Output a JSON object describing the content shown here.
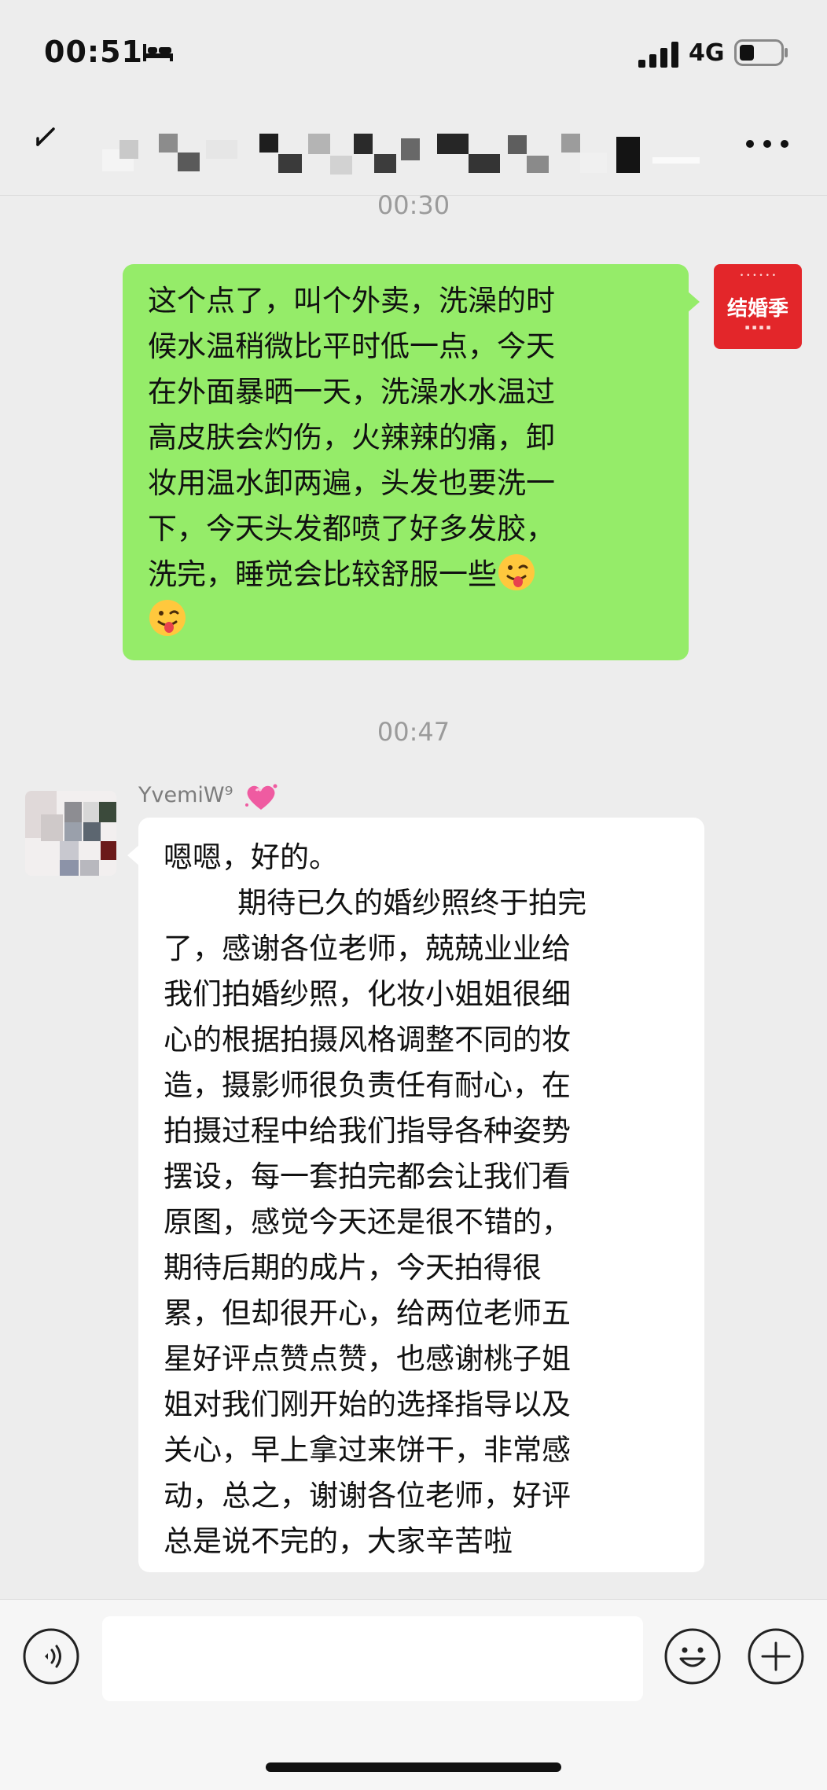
{
  "status_bar": {
    "time": "00:51",
    "network": "4G",
    "sleep_icon": "bed-icon",
    "signal_icon": "signal-bars-icon",
    "battery_icon": "battery-low-icon"
  },
  "nav": {
    "back_icon": "back-arrow-icon",
    "more_icon": "more-dots-icon"
  },
  "messages": {
    "timestamp_1": "00:30",
    "outgoing": {
      "text": "这个点了，叫个外卖，洗澡的时\n候水温稍微比平时低一点，今天\n在外面暴晒一天，洗澡水水温过\n高皮肤会灼伤，火辣辣的痛，卸\n妆用温水卸两遍，头发也要洗一\n下，今天头发都喷了好多发胶，\n洗完，睡觉会比较舒服一些",
      "bubble_color": "#95ec69",
      "avatar_text": "结婚季",
      "avatar_color": "#e3262a"
    },
    "timestamp_2": "00:47",
    "incoming": {
      "sender_name": "YvemiW⁹",
      "text": "嗯嗯，好的。\n        期待已久的婚纱照终于拍完\n了，感谢各位老师，兢兢业业给\n我们拍婚纱照，化妆小姐姐很细\n心的根据拍摄风格调整不同的妆\n造，摄影师很负责任有耐心，在\n拍摄过程中给我们指导各种姿势\n摆设，每一套拍完都会让我们看\n原图，感觉今天还是很不错的，\n期待后期的成片，今天拍得很\n累，但却很开心，给两位老师五\n星好评点赞点赞，也感谢桃子姐\n姐对我们刚开始的选择指导以及\n关心，早上拿过来饼干，非常感\n动，总之，谢谢各位老师，好评\n总是说不完的，大家辛苦啦",
      "bubble_color": "#ffffff"
    }
  },
  "input_bar": {
    "voice_icon": "voice-icon",
    "emoji_icon": "emoji-icon",
    "plus_icon": "plus-icon"
  }
}
